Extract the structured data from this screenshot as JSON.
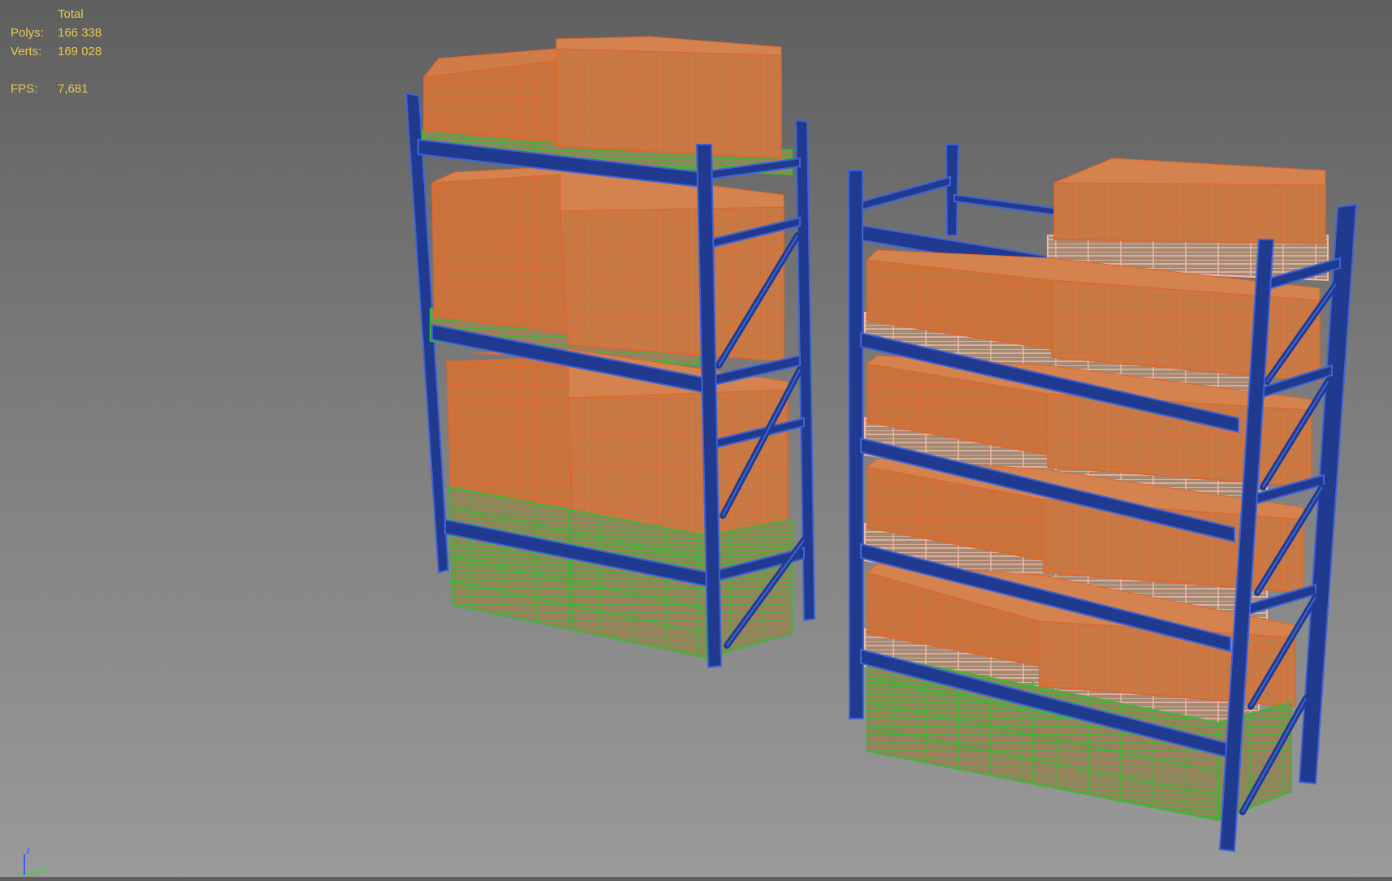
{
  "stats": {
    "header": "Total",
    "polys_label": "Polys:",
    "polys_value": "166 338",
    "verts_label": "Verts:",
    "verts_value": "169 028",
    "fps_label": "FPS:",
    "fps_value": "7,681"
  },
  "gizmo": {
    "z_label": "z",
    "y_label": "y"
  },
  "colors": {
    "background_top": "#5f5f5f",
    "background_bottom": "#9a9a9a",
    "stats_text": "#e8c84a",
    "rack_frame": "#1f3a8f",
    "rack_frame_wire": "#3f63d6",
    "boxes_fill": "#c8743e",
    "boxes_wire": "#e0642a",
    "pallet_green": "#3fb536",
    "pallet_pink": "#f2b7ab",
    "pallet_fill": "#9b7f5f"
  }
}
